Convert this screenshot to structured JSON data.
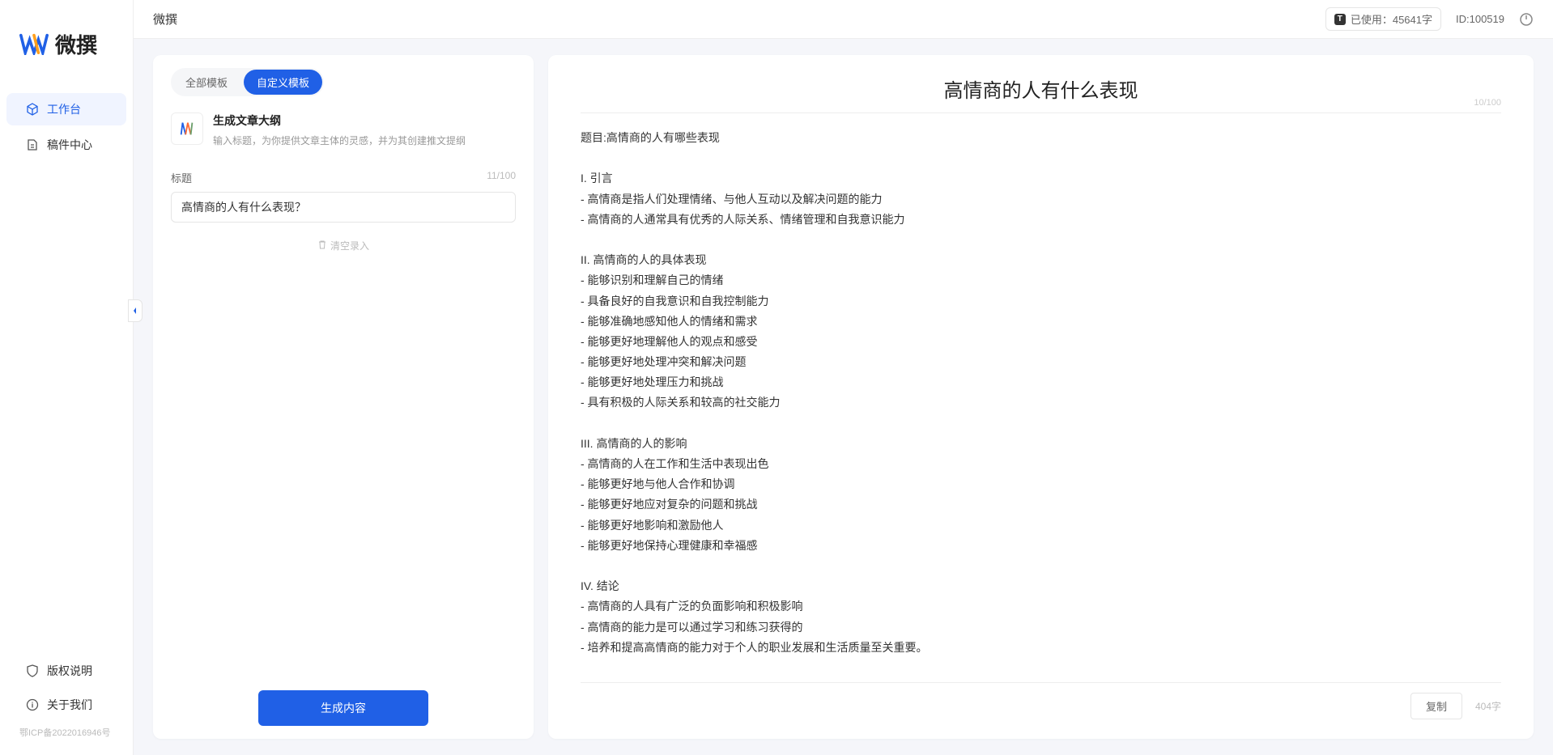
{
  "app": {
    "name": "微撰",
    "logo_text": "微撰"
  },
  "sidebar": {
    "items": [
      {
        "label": "工作台",
        "icon": "cube"
      },
      {
        "label": "稿件中心",
        "icon": "file"
      }
    ],
    "bottom": [
      {
        "label": "版权说明",
        "icon": "shield"
      },
      {
        "label": "关于我们",
        "icon": "info"
      }
    ],
    "icp": "鄂ICP备2022016946号"
  },
  "topbar": {
    "title": "微撰",
    "usage_label": "已使用：45641字",
    "user_id": "ID:100519"
  },
  "left": {
    "tabs": [
      {
        "label": "全部模板",
        "active": false
      },
      {
        "label": "自定义模板",
        "active": true
      }
    ],
    "template": {
      "title": "生成文章大纲",
      "desc": "输入标题，为你提供文章主体的灵感，并为其创建推文提纲"
    },
    "form": {
      "label": "标题",
      "count": "11/100",
      "value": "高情商的人有什么表现？"
    },
    "clear_label": "清空录入",
    "generate_label": "生成内容"
  },
  "right": {
    "title": "高情商的人有什么表现",
    "title_count": "10/100",
    "body": "题目:高情商的人有哪些表现\n\nI. 引言\n- 高情商是指人们处理情绪、与他人互动以及解决问题的能力\n- 高情商的人通常具有优秀的人际关系、情绪管理和自我意识能力\n\nII. 高情商的人的具体表现\n- 能够识别和理解自己的情绪\n- 具备良好的自我意识和自我控制能力\n- 能够准确地感知他人的情绪和需求\n- 能够更好地理解他人的观点和感受\n- 能够更好地处理冲突和解决问题\n- 能够更好地处理压力和挑战\n- 具有积极的人际关系和较高的社交能力\n\nIII. 高情商的人的影响\n- 高情商的人在工作和生活中表现出色\n- 能够更好地与他人合作和协调\n- 能够更好地应对复杂的问题和挑战\n- 能够更好地影响和激励他人\n- 能够更好地保持心理健康和幸福感\n\nIV. 结论\n- 高情商的人具有广泛的负面影响和积极影响\n- 高情商的能力是可以通过学习和练习获得的\n- 培养和提高高情商的能力对于个人的职业发展和生活质量至关重要。",
    "copy_label": "复制",
    "word_count": "404字"
  }
}
